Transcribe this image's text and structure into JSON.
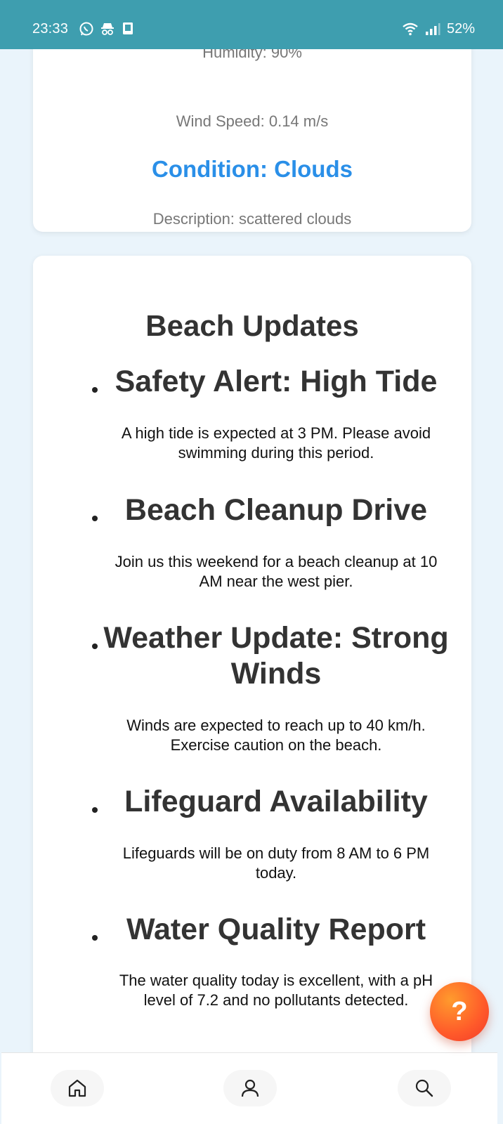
{
  "status_bar": {
    "time": "23:33",
    "left_icons": [
      "whatsapp-icon",
      "incognito-icon",
      "tablet-icon"
    ],
    "right_icons": [
      "wifi-icon",
      "signal-icon"
    ],
    "battery": "52%"
  },
  "weather": {
    "humidity_partial": "Humidity: 90%",
    "wind_speed": "Wind Speed: 0.14 m/s",
    "condition": "Condition: Clouds",
    "description": "Description: scattered clouds"
  },
  "updates": {
    "title": "Beach Updates",
    "items": [
      {
        "heading": "Safety Alert: High Tide",
        "text": "A high tide is expected at 3 PM. Please avoid swimming during this period."
      },
      {
        "heading": "Beach Cleanup Drive",
        "text": "Join us this weekend for a beach cleanup at 10 AM near the west pier."
      },
      {
        "heading": "Weather Update: Strong Winds",
        "text": "Winds are expected to reach up to 40 km/h. Exercise caution on the beach."
      },
      {
        "heading": "Lifeguard Availability",
        "text": "Lifeguards will be on duty from 8 AM to 6 PM today."
      },
      {
        "heading": "Water Quality Report",
        "text": "The water quality today is excellent, with a pH level of 7.2 and no pollutants detected."
      }
    ]
  },
  "help_button": {
    "label": "?"
  },
  "bottom_nav": [
    {
      "icon": "home-icon"
    },
    {
      "icon": "user-icon"
    },
    {
      "icon": "search-icon"
    }
  ],
  "colors": {
    "status_bar": "#3e9eaf",
    "condition_text": "#2a8fe8",
    "page_background": "#eaf4fb",
    "help_button": "#ff5a2a"
  }
}
